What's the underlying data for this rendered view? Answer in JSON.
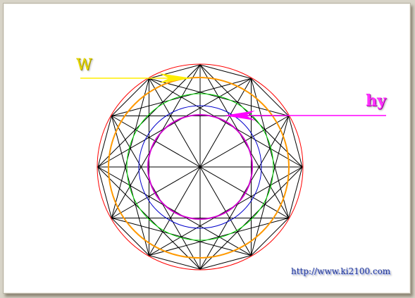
{
  "labels": {
    "w": "W",
    "hy": "hy",
    "url": "http://www.ki2100.com"
  },
  "colors": {
    "outer_circle": "#ff0000",
    "orange_circle": "#ff9900",
    "green_circle": "#00dd00",
    "blue_circle": "#0000cc",
    "magenta_circle": "#cc00cc",
    "lines": "#000000",
    "w_arrow": "#ffee00",
    "hy_arrow": "#ff00ff"
  }
}
